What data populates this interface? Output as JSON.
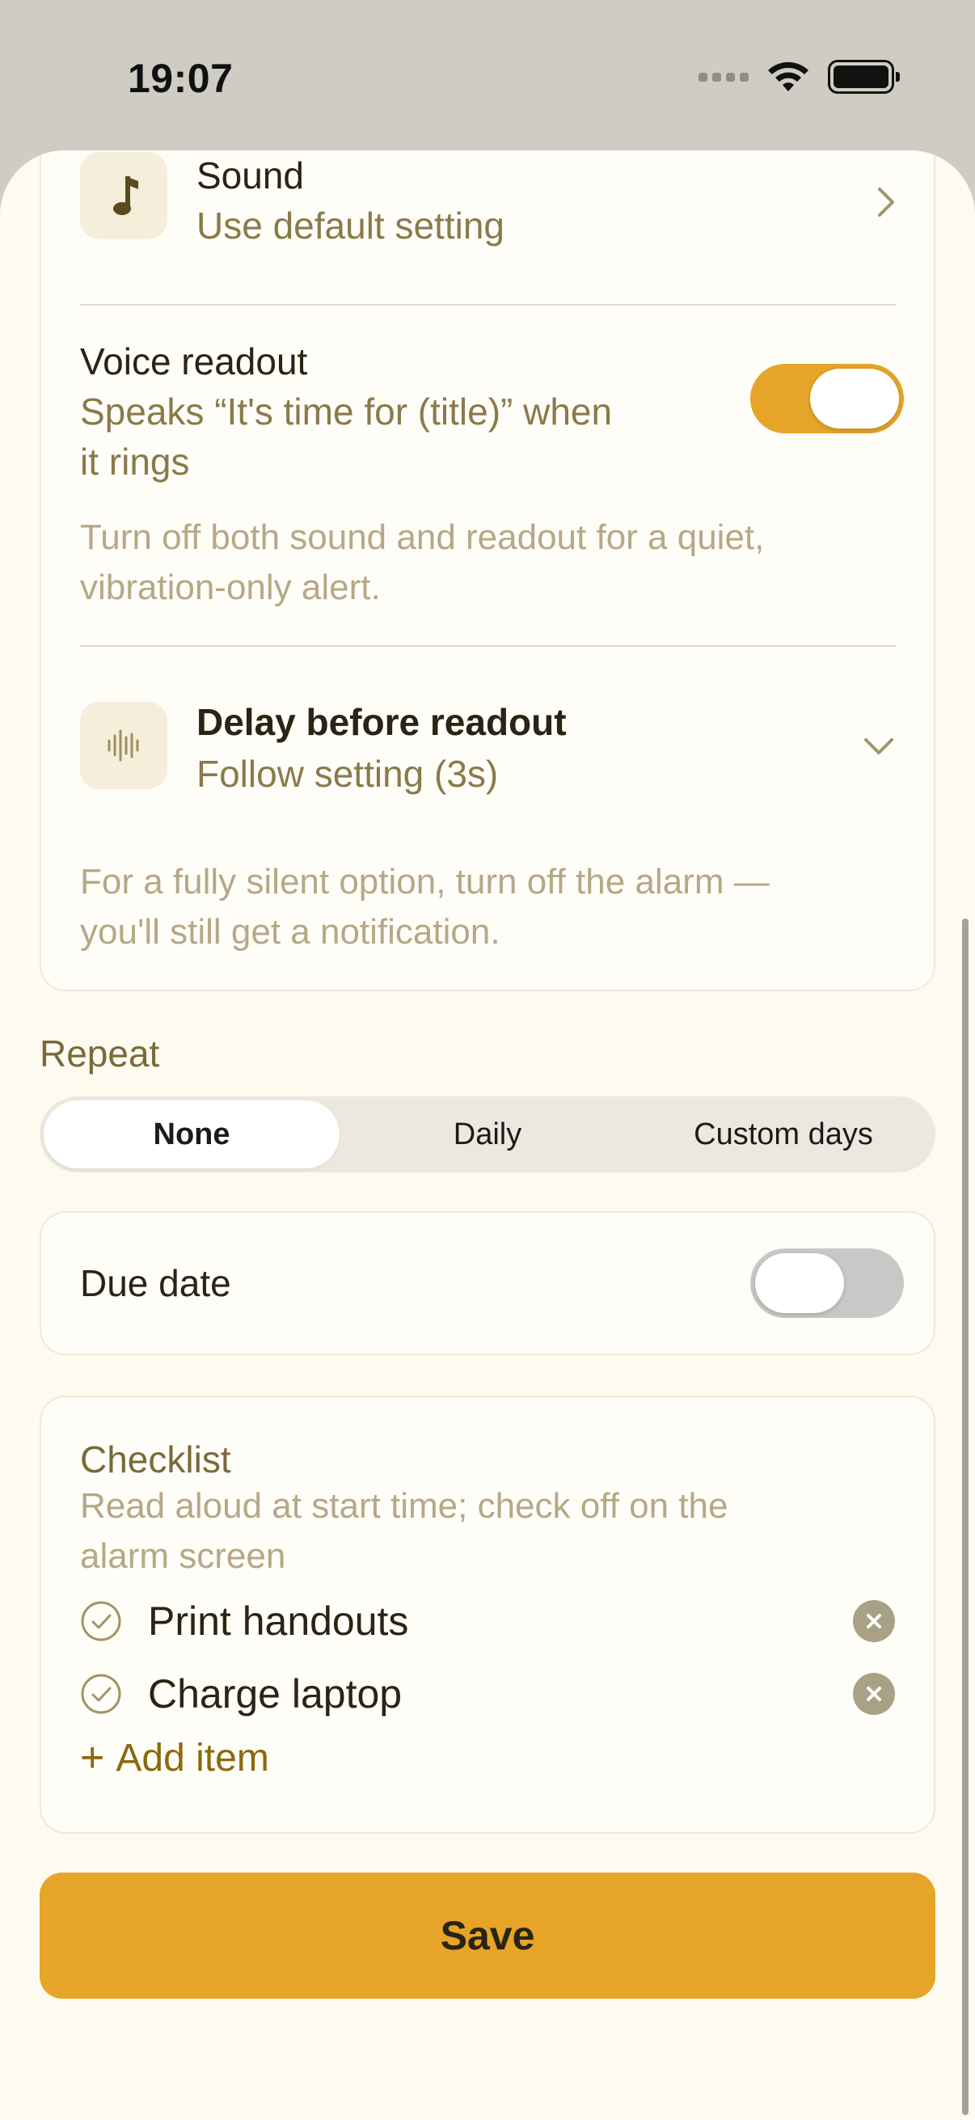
{
  "status_bar": {
    "time": "19:07"
  },
  "sound": {
    "title": "Sound",
    "subtitle": "Use default setting"
  },
  "voice_readout": {
    "title": "Voice readout",
    "subtitle_line1": "Speaks “It's time for (title)” when",
    "subtitle_line2": "it rings",
    "enabled": true,
    "hint_line1": "Turn off both sound and readout for a quiet,",
    "hint_line2": "vibration-only alert."
  },
  "delay": {
    "title": "Delay before readout",
    "subtitle": "Follow setting (3s)"
  },
  "silent_hint": {
    "line1": "For a fully silent option, turn off the alarm —",
    "line2": "you'll still get a notification."
  },
  "repeat": {
    "label": "Repeat",
    "options": [
      "None",
      "Daily",
      "Custom days"
    ],
    "selected": "None"
  },
  "due_date": {
    "label": "Due date",
    "enabled": false
  },
  "checklist": {
    "title": "Checklist",
    "desc_line1": "Read aloud at start time; check off on the",
    "desc_line2": "alarm screen",
    "items": [
      "Print handouts",
      "Charge laptop"
    ],
    "add_label": "Add item"
  },
  "save_label": "Save",
  "colors": {
    "accent": "#e6a428",
    "background": "#fdfaf0"
  }
}
